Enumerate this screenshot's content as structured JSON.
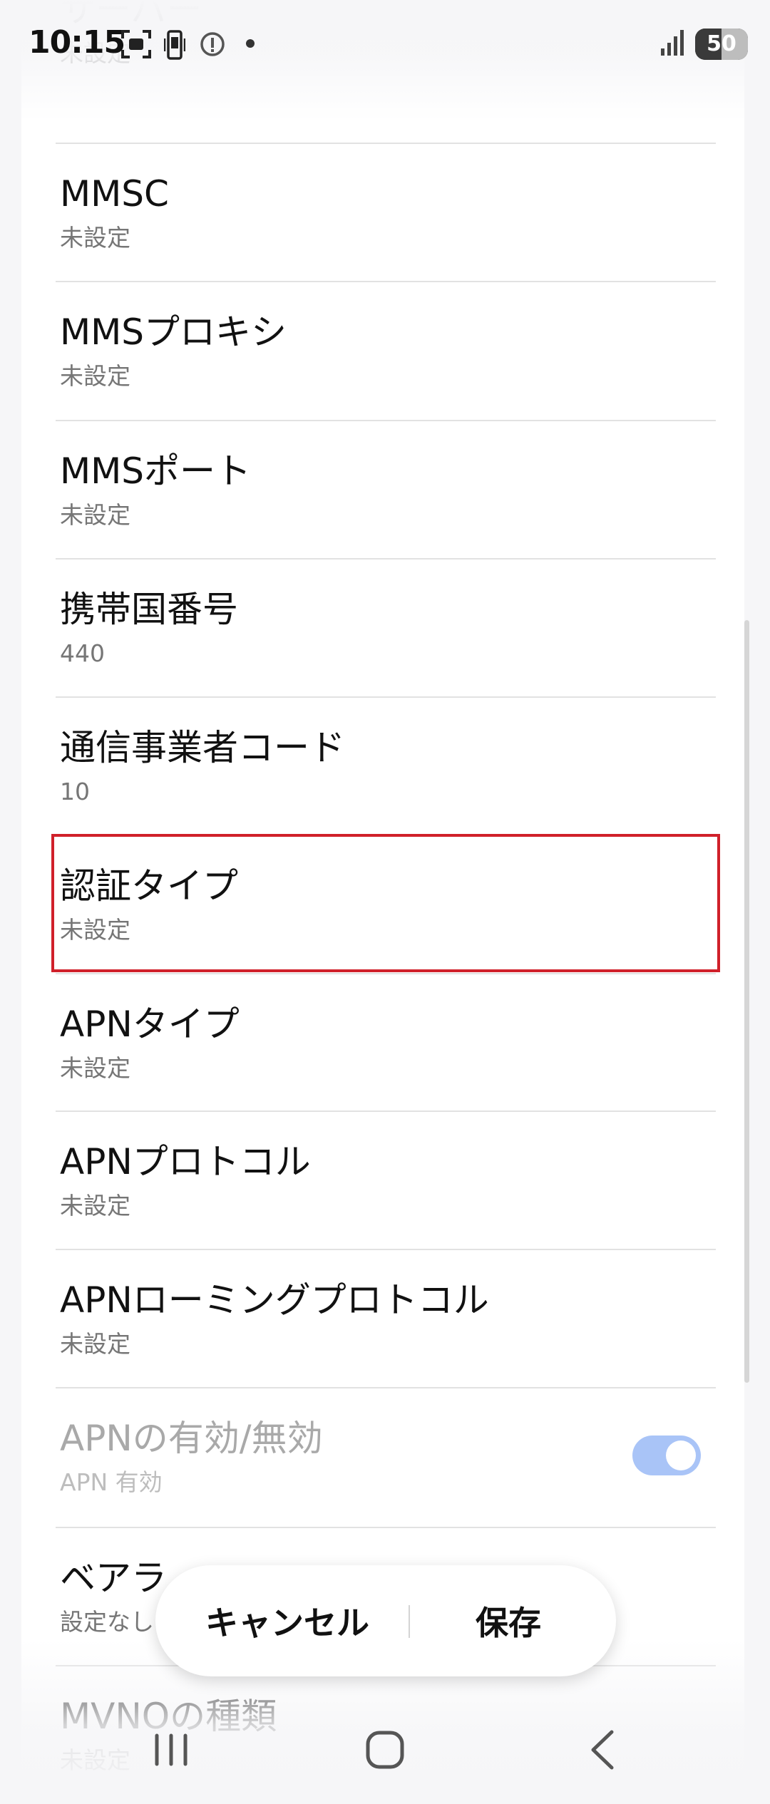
{
  "status_bar": {
    "time": "10:15",
    "battery": "50"
  },
  "settings": {
    "items": [
      {
        "title": "サーバー",
        "summary": "未設定"
      },
      {
        "title": "MMSC",
        "summary": "未設定"
      },
      {
        "title": "MMSプロキシ",
        "summary": "未設定"
      },
      {
        "title": "MMSポート",
        "summary": "未設定"
      },
      {
        "title": "携帯国番号",
        "summary": "440"
      },
      {
        "title": "通信事業者コード",
        "summary": "10"
      },
      {
        "title": "認証タイプ",
        "summary": "未設定"
      },
      {
        "title": "APNタイプ",
        "summary": "未設定"
      },
      {
        "title": "APNプロトコル",
        "summary": "未設定"
      },
      {
        "title": "APNローミングプロトコル",
        "summary": "未設定"
      },
      {
        "title": "APNの有効/無効",
        "summary": "APN 有効",
        "toggle_on": true
      },
      {
        "title": "ベアラ",
        "summary": "設定なし"
      },
      {
        "title": "MVNOの種類",
        "summary": "未設定"
      }
    ]
  },
  "actions": {
    "cancel_label": "キャンセル",
    "save_label": "保存"
  },
  "colors": {
    "accent_toggle": "#a9c4f7",
    "highlight_border": "#d0202a"
  }
}
